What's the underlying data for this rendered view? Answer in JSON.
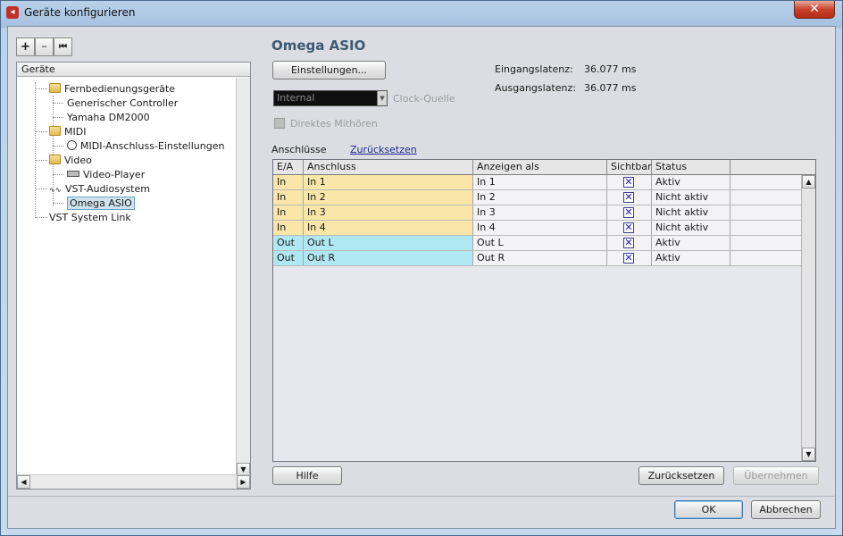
{
  "window": {
    "title": "Geräte konfigurieren",
    "close_glyph": "✕"
  },
  "toolbar": {
    "add": "+",
    "remove": "–",
    "reset": "⏮"
  },
  "tree": {
    "header": "Geräte",
    "items": [
      {
        "label": "Fernbedienungsgeräte",
        "icon": "folder-icon"
      },
      {
        "label": "Generischer Controller",
        "icon": "none"
      },
      {
        "label": "Yamaha DM2000",
        "icon": "none"
      },
      {
        "label": "MIDI",
        "icon": "folder-icon"
      },
      {
        "label": "MIDI-Anschluss-Einstellungen",
        "icon": "midi-port-icon"
      },
      {
        "label": "Video",
        "icon": "folder-icon"
      },
      {
        "label": "Video-Player",
        "icon": "video-player-icon"
      },
      {
        "label": "VST-Audiosystem",
        "icon": "audio-system-icon"
      },
      {
        "label": "Omega ASIO",
        "icon": "none",
        "selected": true
      },
      {
        "label": "VST System Link",
        "icon": "none"
      }
    ]
  },
  "device": {
    "title": "Omega ASIO",
    "settings_button": "Einstellungen...",
    "input_latency_label": "Eingangslatenz:",
    "input_latency_value": "36.077 ms",
    "output_latency_label": "Ausgangslatenz:",
    "output_latency_value": "36.077 ms",
    "clock_source_value": "Internal",
    "clock_source_label": "Clock-Quelle",
    "direct_monitoring_label": "Direktes Mithören",
    "ports_label": "Anschlüsse",
    "reset_link": "Zurücksetzen"
  },
  "grid": {
    "columns": [
      "E/A",
      "Anschluss",
      "Anzeigen als",
      "Sichtbar",
      "Status"
    ],
    "rows": [
      {
        "io": "In",
        "port": "In 1",
        "display": "In 1",
        "visible": true,
        "status": "Aktiv",
        "type": "in"
      },
      {
        "io": "In",
        "port": "In 2",
        "display": "In 2",
        "visible": true,
        "status": "Nicht aktiv",
        "type": "in"
      },
      {
        "io": "In",
        "port": "In 3",
        "display": "In 3",
        "visible": true,
        "status": "Nicht aktiv",
        "type": "in"
      },
      {
        "io": "In",
        "port": "In 4",
        "display": "In 4",
        "visible": true,
        "status": "Nicht aktiv",
        "type": "in"
      },
      {
        "io": "Out",
        "port": "Out L",
        "display": "Out L",
        "visible": true,
        "status": "Aktiv",
        "type": "out"
      },
      {
        "io": "Out",
        "port": "Out R",
        "display": "Out R",
        "visible": true,
        "status": "Aktiv",
        "type": "out"
      }
    ],
    "check_glyph": "✕"
  },
  "buttons": {
    "help": "Hilfe",
    "reset": "Zurücksetzen",
    "apply": "Übernehmen",
    "ok": "OK",
    "cancel": "Abbrechen"
  },
  "colors": {
    "in_row": "#f9e6a8",
    "out_row": "#b0e8f2",
    "accent": "#3c5a72"
  }
}
